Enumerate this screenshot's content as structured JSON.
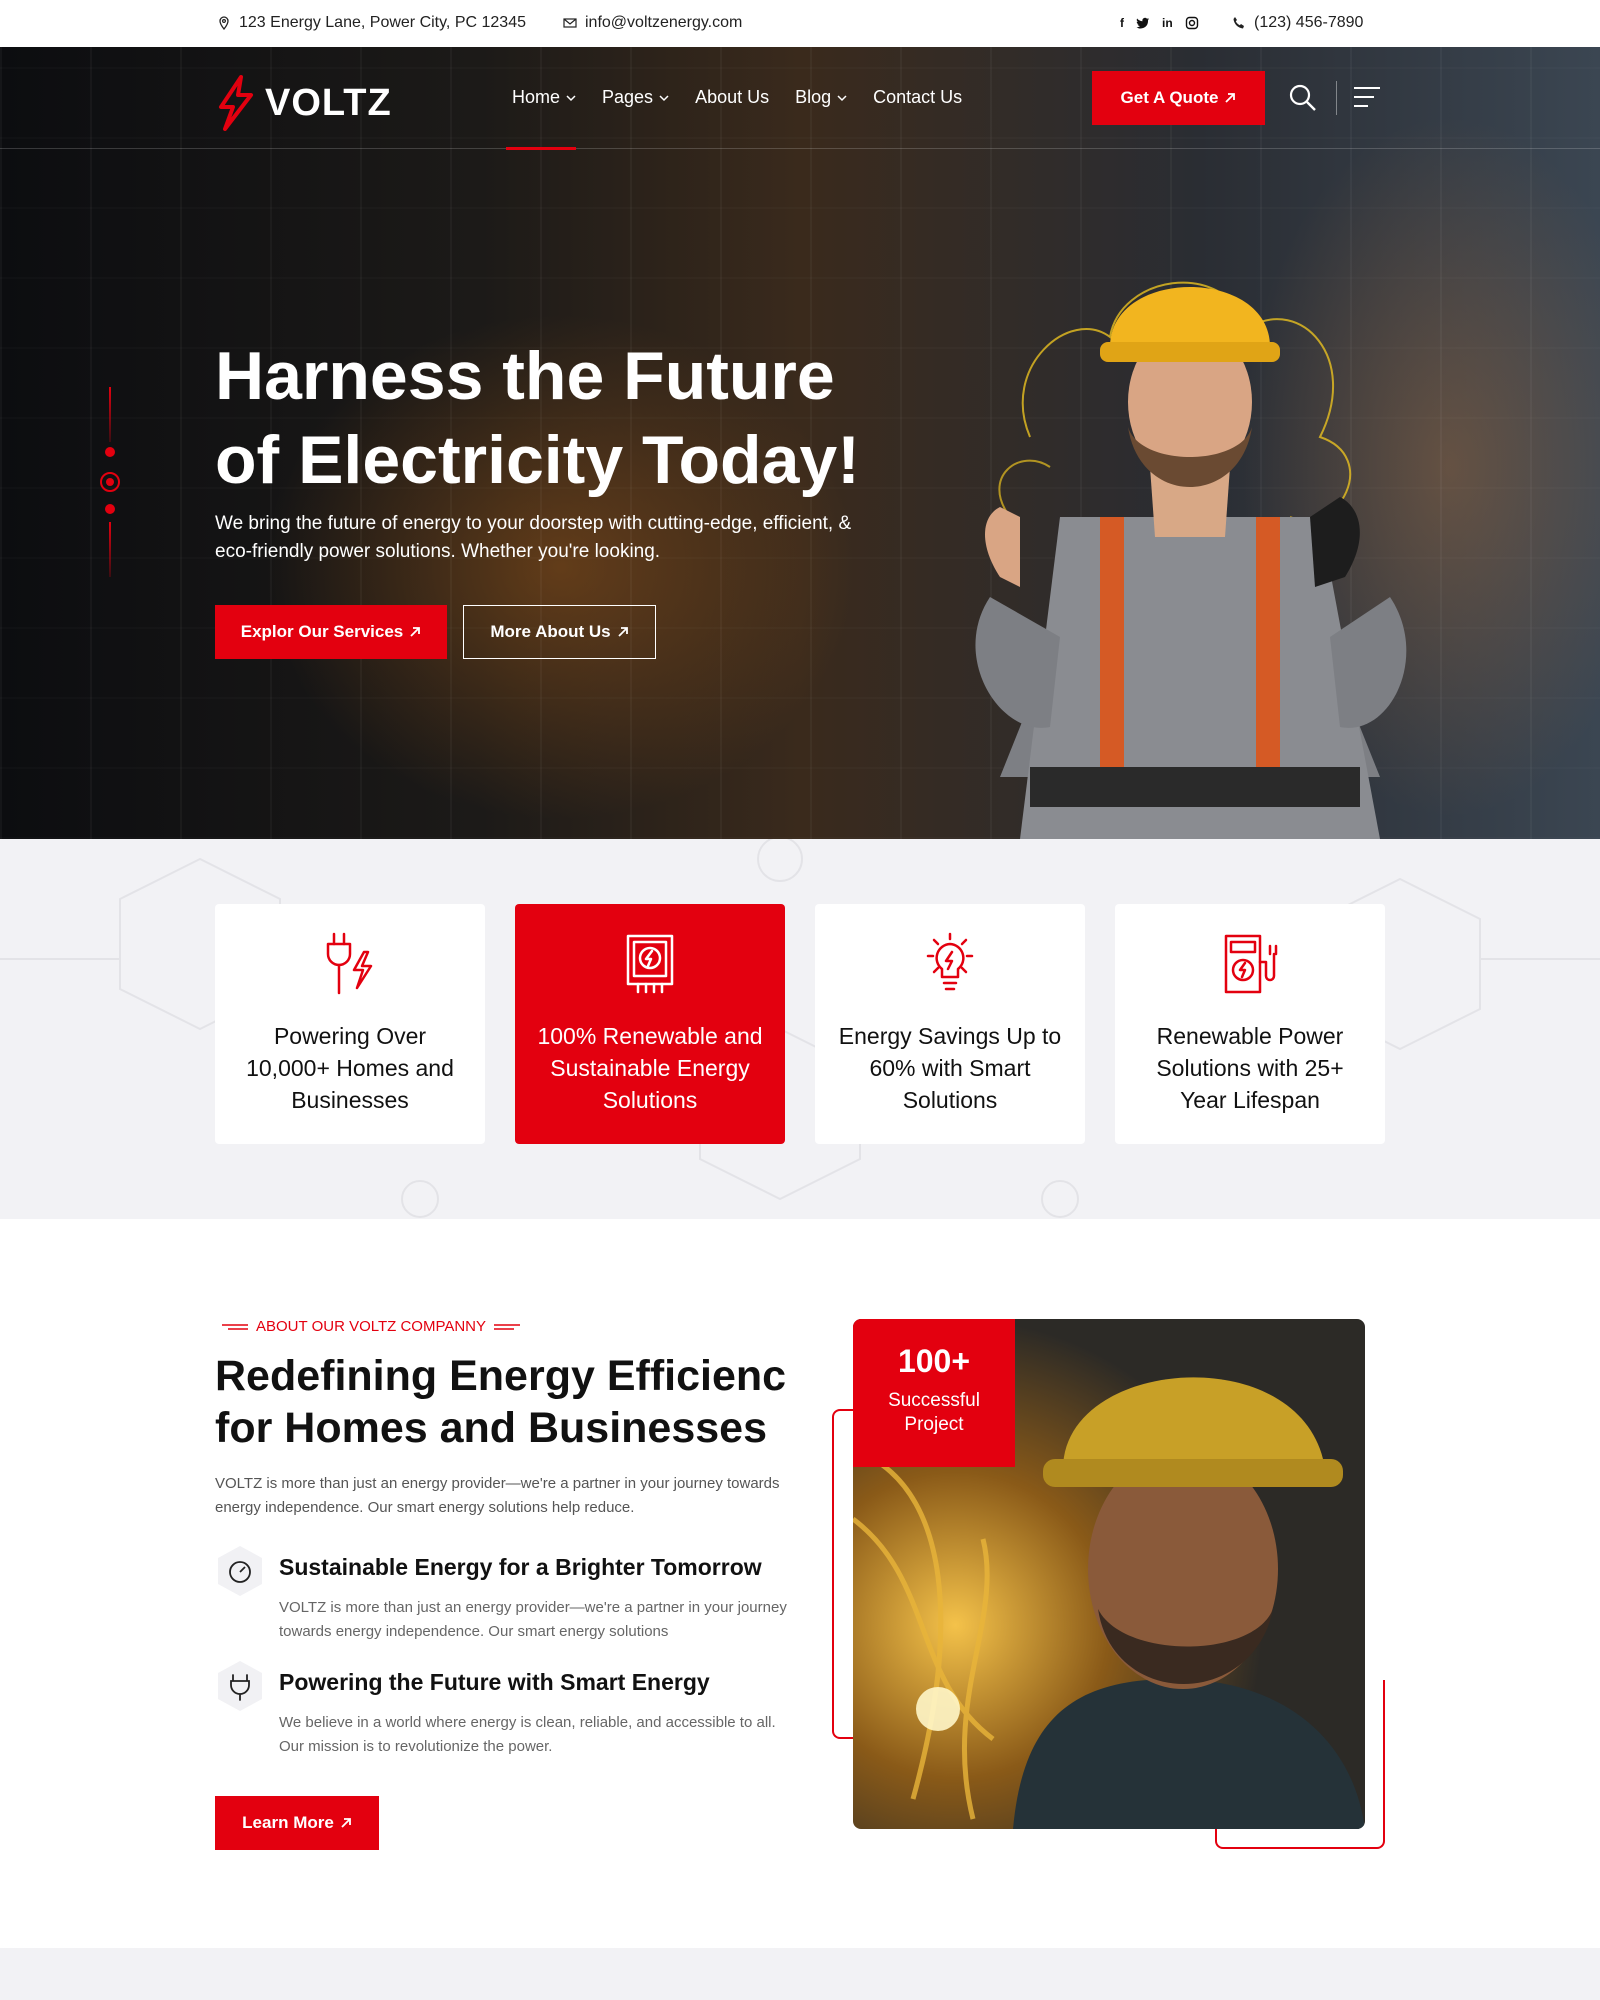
{
  "topbar": {
    "address": "123 Energy Lane, Power City, PC 12345",
    "email": "info@voltzenergy.com",
    "phone": "(123) 456-7890",
    "social": {
      "facebook": "f",
      "twitter": "t",
      "linkedin": "in",
      "instagram": "ig"
    }
  },
  "brand": {
    "name": "VOLTZ",
    "accent": "#e3000f"
  },
  "nav": {
    "items": [
      {
        "label": "Home",
        "has_dropdown": true,
        "active": true
      },
      {
        "label": "Pages",
        "has_dropdown": true
      },
      {
        "label": "About Us",
        "has_dropdown": false
      },
      {
        "label": "Blog",
        "has_dropdown": true
      },
      {
        "label": "Contact Us",
        "has_dropdown": false
      }
    ],
    "cta": "Get A Quote"
  },
  "hero": {
    "title": "Harness the Future of Electricity Today!",
    "subtitle": "We bring the future of energy to your doorstep with cutting-edge, efficient, & eco-friendly power solutions. Whether you're looking.",
    "primary_button": "Explor Our Services",
    "secondary_button": "More About Us"
  },
  "features": [
    {
      "icon": "plug-icon",
      "text": "Powering Over 10,000+ Homes and Businesses",
      "active": false
    },
    {
      "icon": "meter-icon",
      "text": "100% Renewable and Sustainable Energy Solutions",
      "active": true
    },
    {
      "icon": "bulb-icon",
      "text": "Energy Savings Up to 60% with Smart Solutions",
      "active": false
    },
    {
      "icon": "charger-icon",
      "text": "Renewable Power Solutions with 25+ Year Lifespan",
      "active": false
    }
  ],
  "about": {
    "label": "ABOUT OUR VOLTZ COMPANNY",
    "title": "Redefining Energy Efficienc for Homes and Businesses",
    "description": "VOLTZ is more than just an energy provider—we're a partner in your journey towards energy independence. Our smart energy solutions help reduce.",
    "points": [
      {
        "icon": "gauge-icon",
        "title": "Sustainable Energy for a Brighter Tomorrow",
        "text": "VOLTZ is more than just an energy provider—we're a partner in your journey towards energy independence. Our smart energy solutions"
      },
      {
        "icon": "plug-connect-icon",
        "title": "Powering the Future with Smart Energy",
        "text": "We believe in a world where energy is clean, reliable, and accessible to all. Our mission is to revolutionize the power."
      }
    ],
    "button": "Learn More",
    "stat": {
      "number": "100+",
      "label": "Successful Project"
    }
  }
}
